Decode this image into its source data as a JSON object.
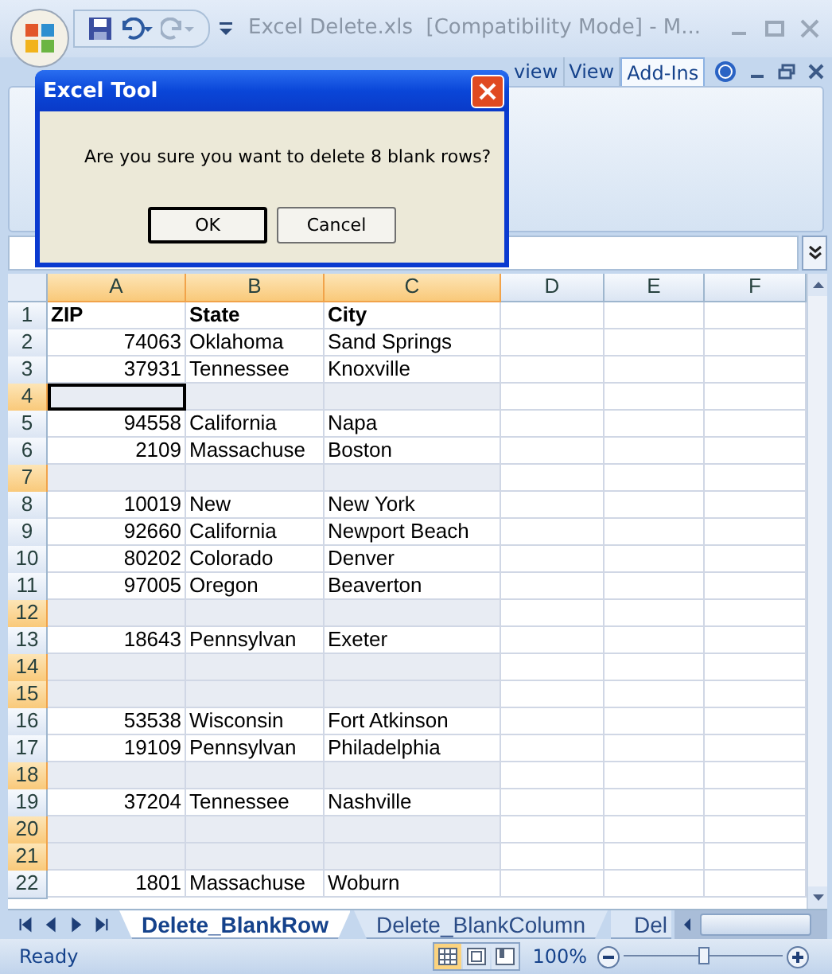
{
  "window": {
    "title": "Excel Delete.xls  [Compatibility Mode] - M..."
  },
  "ribbon_tabs": [
    {
      "label": "view",
      "selected": false
    },
    {
      "label": "View",
      "selected": false
    },
    {
      "label": "Add-Ins",
      "selected": true
    }
  ],
  "dialog": {
    "title": "Excel Tool",
    "message": "Are you sure you want to delete 8 blank rows?",
    "buttons": [
      {
        "label": "OK",
        "default": true
      },
      {
        "label": "Cancel",
        "default": false
      }
    ]
  },
  "sheet": {
    "columns": [
      {
        "label": "A",
        "selected": true
      },
      {
        "label": "B",
        "selected": true
      },
      {
        "label": "C",
        "selected": true
      },
      {
        "label": "D",
        "selected": false
      },
      {
        "label": "E",
        "selected": false
      },
      {
        "label": "F",
        "selected": false
      }
    ],
    "rows": [
      {
        "number": "1",
        "kind": "header",
        "selected": false,
        "active": false,
        "cells": [
          "ZIP",
          "State",
          "City"
        ]
      },
      {
        "number": "2",
        "kind": "data",
        "selected": false,
        "active": false,
        "cells": [
          "74063",
          "Oklahoma",
          "Sand Springs"
        ]
      },
      {
        "number": "3",
        "kind": "data",
        "selected": false,
        "active": false,
        "cells": [
          "37931",
          "Tennessee",
          "Knoxville"
        ]
      },
      {
        "number": "4",
        "kind": "blank",
        "selected": true,
        "active": true,
        "cells": []
      },
      {
        "number": "5",
        "kind": "data",
        "selected": false,
        "active": false,
        "cells": [
          "94558",
          "California",
          "Napa"
        ]
      },
      {
        "number": "6",
        "kind": "data",
        "selected": false,
        "active": false,
        "cells": [
          "2109",
          "Massachuse",
          "Boston"
        ]
      },
      {
        "number": "7",
        "kind": "blank",
        "selected": true,
        "active": false,
        "cells": []
      },
      {
        "number": "8",
        "kind": "data",
        "selected": false,
        "active": false,
        "cells": [
          "10019",
          "New",
          "New York"
        ]
      },
      {
        "number": "9",
        "kind": "data",
        "selected": false,
        "active": false,
        "cells": [
          "92660",
          "California",
          "Newport Beach"
        ]
      },
      {
        "number": "10",
        "kind": "data",
        "selected": false,
        "active": false,
        "cells": [
          "80202",
          "Colorado",
          "Denver"
        ]
      },
      {
        "number": "11",
        "kind": "data",
        "selected": false,
        "active": false,
        "cells": [
          "97005",
          "Oregon",
          "Beaverton"
        ]
      },
      {
        "number": "12",
        "kind": "blank",
        "selected": true,
        "active": false,
        "cells": []
      },
      {
        "number": "13",
        "kind": "data",
        "selected": false,
        "active": false,
        "cells": [
          "18643",
          "Pennsylvan",
          "Exeter"
        ]
      },
      {
        "number": "14",
        "kind": "blank",
        "selected": true,
        "active": false,
        "cells": []
      },
      {
        "number": "15",
        "kind": "blank",
        "selected": true,
        "active": false,
        "cells": []
      },
      {
        "number": "16",
        "kind": "data",
        "selected": false,
        "active": false,
        "cells": [
          "53538",
          "Wisconsin",
          "Fort Atkinson"
        ]
      },
      {
        "number": "17",
        "kind": "data",
        "selected": false,
        "active": false,
        "cells": [
          "19109",
          "Pennsylvan",
          "Philadelphia"
        ]
      },
      {
        "number": "18",
        "kind": "blank",
        "selected": true,
        "active": false,
        "cells": []
      },
      {
        "number": "19",
        "kind": "data",
        "selected": false,
        "active": false,
        "cells": [
          "37204",
          "Tennessee",
          "Nashville"
        ]
      },
      {
        "number": "20",
        "kind": "blank",
        "selected": true,
        "active": false,
        "cells": []
      },
      {
        "number": "21",
        "kind": "blank",
        "selected": true,
        "active": false,
        "cells": []
      },
      {
        "number": "22",
        "kind": "data",
        "selected": false,
        "active": false,
        "cells": [
          "1801",
          "Massachuse",
          "Woburn"
        ]
      }
    ]
  },
  "sheet_tabs": [
    {
      "label": "Delete_BlankRow",
      "selected": true
    },
    {
      "label": "Delete_BlankColumn",
      "selected": false
    },
    {
      "label": "Del",
      "selected": false
    }
  ],
  "status_bar": {
    "text": "Ready",
    "zoom": "100%",
    "zoom_slider": {
      "level": 0.5
    },
    "views": [
      {
        "selected": true
      },
      {
        "selected": false
      },
      {
        "selected": false
      }
    ]
  }
}
